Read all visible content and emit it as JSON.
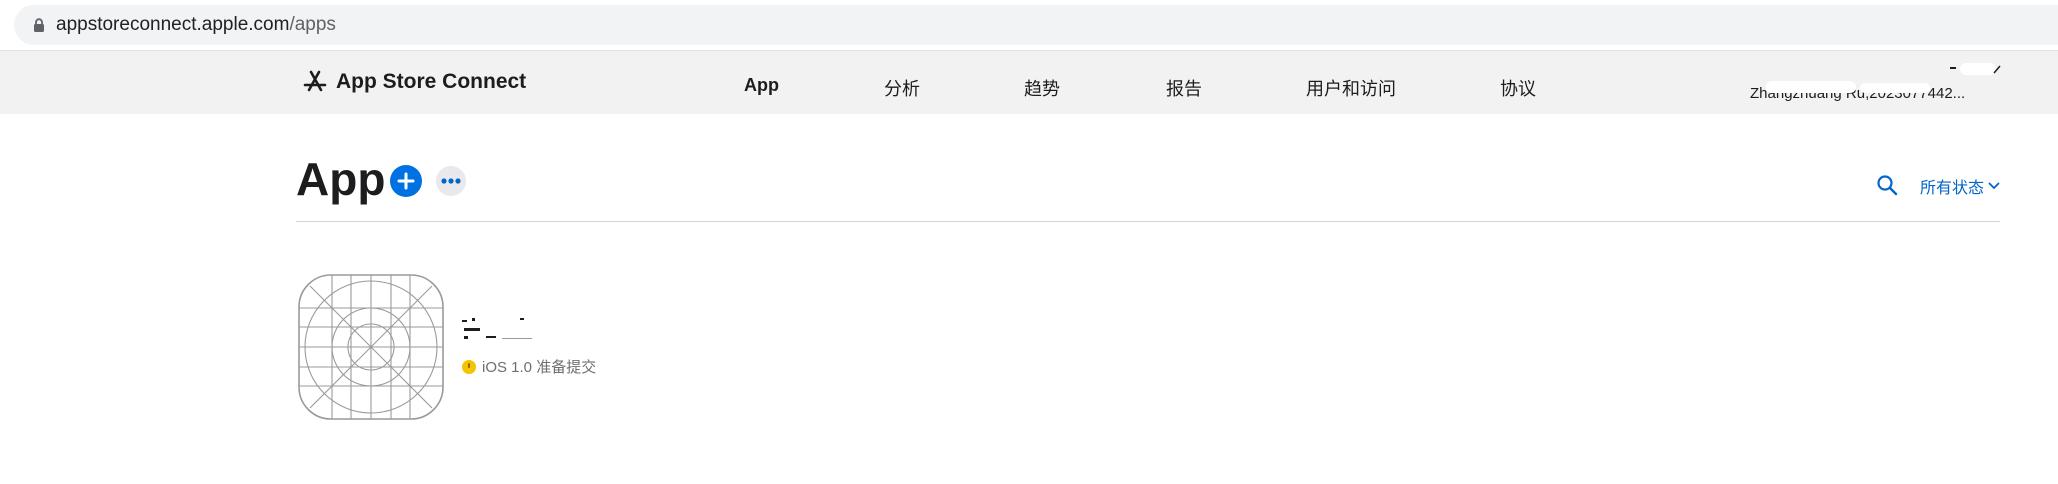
{
  "browser": {
    "url_host": "appstoreconnect.apple.com",
    "url_path": "/apps",
    "lock_icon": "lock-icon"
  },
  "nav": {
    "brand": "App Store Connect",
    "brand_icon": "app-store-icon",
    "items": [
      {
        "label": "App",
        "active": true
      },
      {
        "label": "分析",
        "active": false
      },
      {
        "label": "趋势",
        "active": false
      },
      {
        "label": "报告",
        "active": false
      },
      {
        "label": "用户和访问",
        "active": false
      },
      {
        "label": "协议",
        "active": false
      }
    ],
    "user_name": "Zhangzhuang Ru,2023077442..."
  },
  "page": {
    "title": "App",
    "add_icon": "plus-icon",
    "more_icon": "ellipsis-icon",
    "search_icon": "search-icon",
    "status_filter": "所有状态",
    "accent_color": "#0066cc"
  },
  "apps": [
    {
      "status_text": "iOS 1.0 准备提交",
      "status_color": "#f5c400"
    }
  ]
}
